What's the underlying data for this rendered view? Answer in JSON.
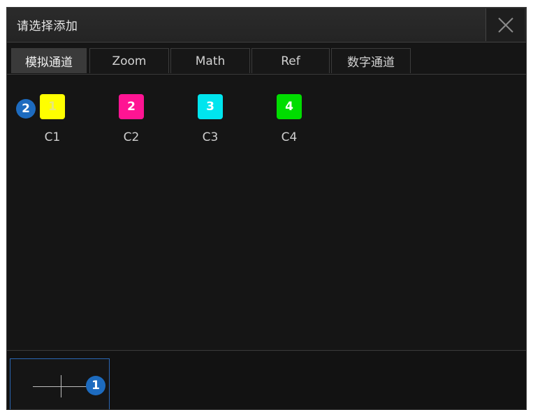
{
  "dialog": {
    "title": "请选择添加",
    "close_icon": "close-icon"
  },
  "tabs": [
    {
      "label": "模拟通道",
      "active": true
    },
    {
      "label": "Zoom",
      "active": false
    },
    {
      "label": "Math",
      "active": false
    },
    {
      "label": "Ref",
      "active": false
    },
    {
      "label": "数字通道",
      "active": false
    }
  ],
  "channels": [
    {
      "number": "1",
      "label": "C1",
      "color": "#ffff00",
      "text_color": "#e8e87a"
    },
    {
      "number": "2",
      "label": "C2",
      "color": "#ff1493",
      "text_color": "#ffffff"
    },
    {
      "number": "3",
      "label": "C3",
      "color": "#00e5ee",
      "text_color": "#ffffff"
    },
    {
      "number": "4",
      "label": "C4",
      "color": "#00dd00",
      "text_color": "#ffffff"
    }
  ],
  "badges": {
    "step_1": "1",
    "step_2": "2"
  },
  "colors": {
    "badge": "#1d6bbf",
    "selection_border": "#2a67b5"
  }
}
